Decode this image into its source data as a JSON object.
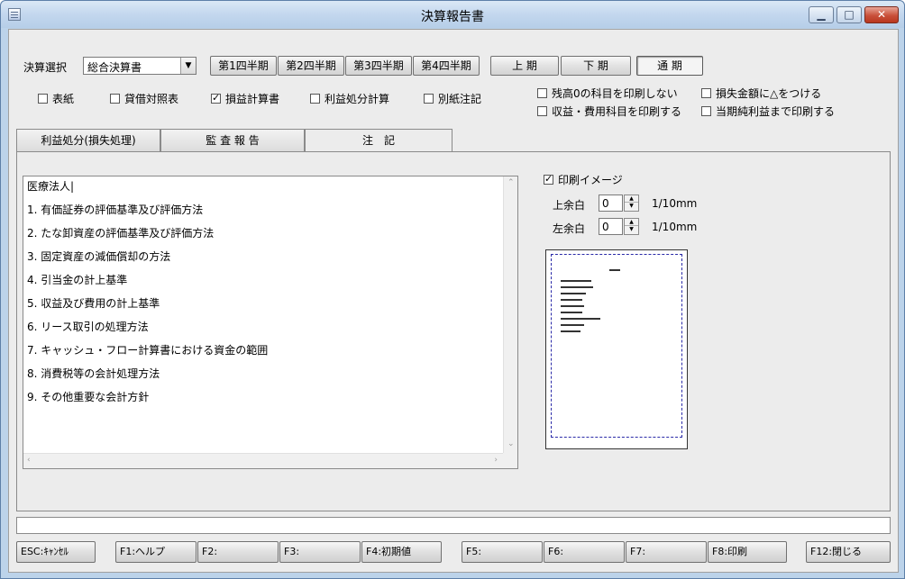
{
  "window": {
    "title": "決算報告書"
  },
  "toolbar": {
    "select_label": "決算選択",
    "select_value": "総合決算書",
    "quarters": [
      "第1四半期",
      "第2四半期",
      "第3四半期",
      "第4四半期"
    ],
    "period_first": "上 期",
    "period_second": "下 期",
    "period_full": "通 期"
  },
  "documents": {
    "cover": {
      "label": "表紙",
      "checked": false
    },
    "balance_sheet": {
      "label": "貸借対照表",
      "checked": false
    },
    "income_statement": {
      "label": "損益計算書",
      "checked": true
    },
    "appropriation": {
      "label": "利益処分計算",
      "checked": false
    },
    "notes": {
      "label": "別紙注記",
      "checked": false
    }
  },
  "options": {
    "skip_zero": {
      "label": "残高0の科目を印刷しない",
      "checked": false
    },
    "print_revenue": {
      "label": "収益・費用科目を印刷する",
      "checked": false
    },
    "triangle_loss": {
      "label": "損失金額に△をつける",
      "checked": false
    },
    "up_to_net": {
      "label": "当期純利益まで印刷する",
      "checked": false
    }
  },
  "tabs": [
    {
      "label": "利益処分(損失処理)"
    },
    {
      "label": "監 査 報 告"
    },
    {
      "label": "注　記"
    }
  ],
  "notes_editor": {
    "lines": [
      "医療法人|",
      "1. 有価証券の評価基準及び評価方法",
      "2. たな卸資産の評価基準及び評価方法",
      "3. 固定資産の減価償却の方法",
      "4. 引当金の計上基準",
      "5. 収益及び費用の計上基準",
      "6. リース取引の処理方法",
      "7. キャッシュ・フロー計算書における資金の範囲",
      "8. 消費税等の会計処理方法",
      "9. その他重要な会計方針"
    ]
  },
  "print_image": {
    "label": "印刷イメージ",
    "checked": true,
    "top_margin_label": "上余白",
    "top_margin_value": "0",
    "left_margin_label": "左余白",
    "left_margin_value": "0",
    "unit": "1/10mm"
  },
  "function_keys": [
    "ESC:ｷｬﾝｾﾙ",
    "F1:ヘルプ",
    "F2:",
    "F3:",
    "F4:初期値",
    "F5:",
    "F6:",
    "F7:",
    "F8:印刷",
    "F12:閉じる"
  ],
  "icons": [
    "app-icon",
    "minimize-icon",
    "maximize-icon",
    "close-icon",
    "checkbox-icon",
    "chevron-down-icon"
  ]
}
